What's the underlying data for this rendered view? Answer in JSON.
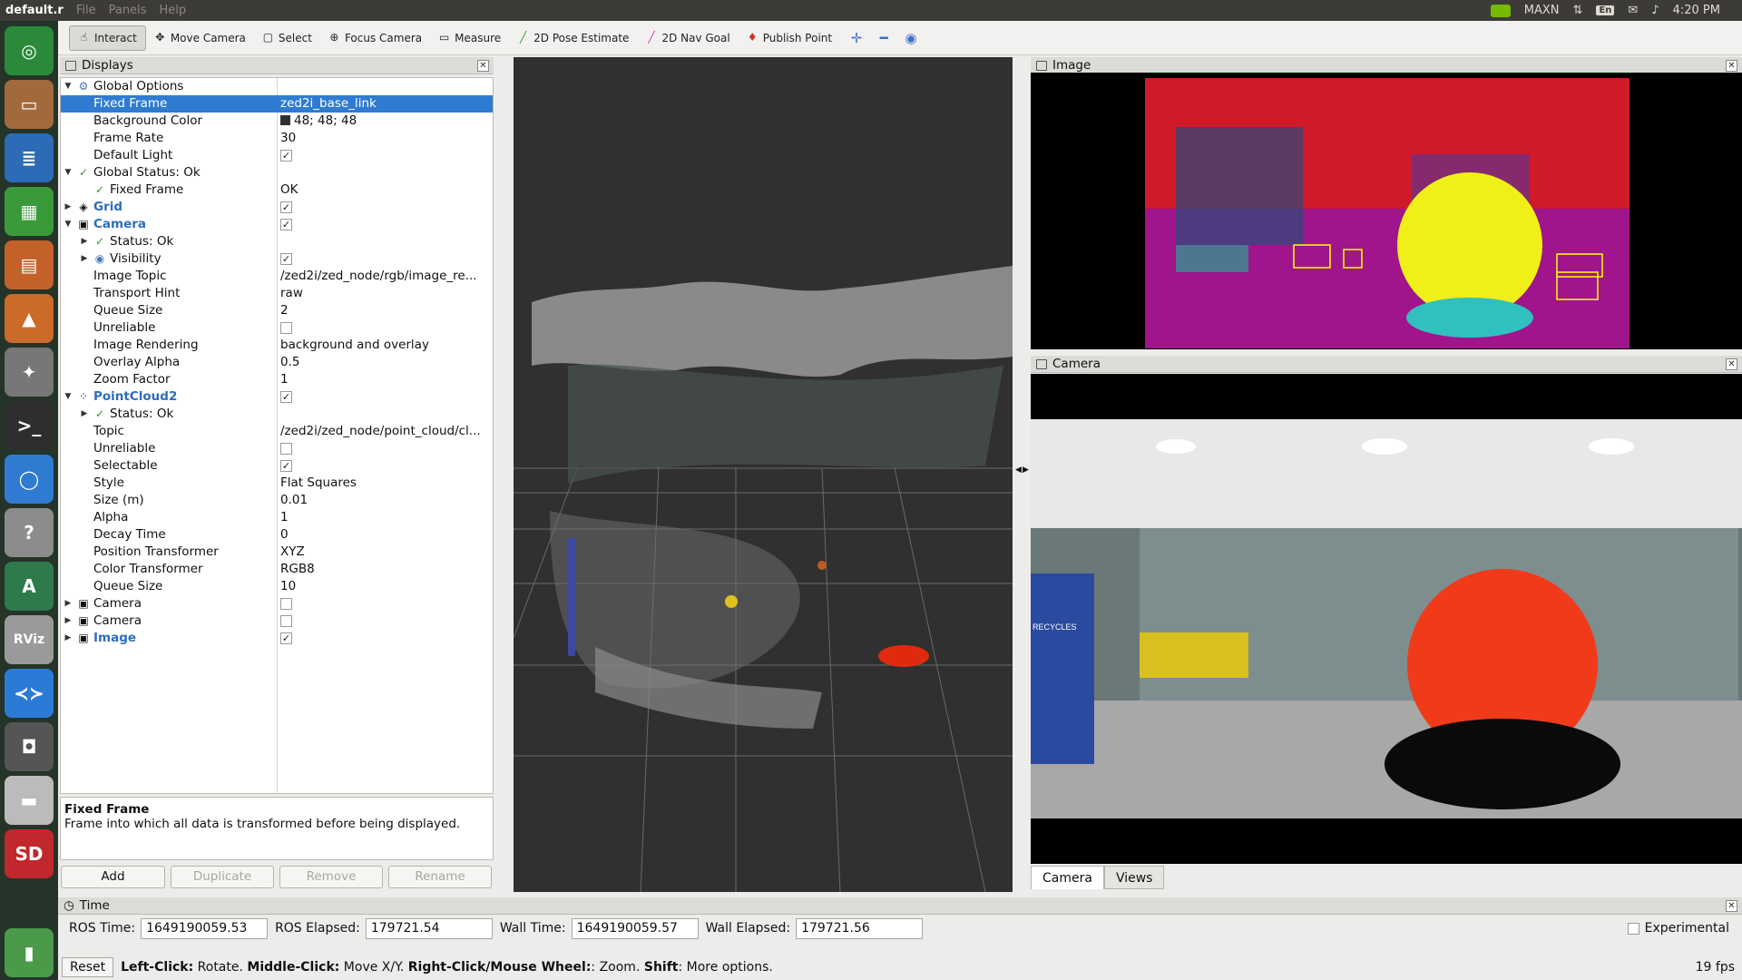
{
  "topbar": {
    "window_title": "default.r",
    "menus": [
      "File",
      "Panels",
      "Help"
    ],
    "nv_label": "MAXN",
    "lang": "En",
    "clock": "4:20 PM"
  },
  "toolbar": {
    "tools": [
      {
        "label": "Interact",
        "icon": "hand-cursor-icon",
        "active": true
      },
      {
        "label": "Move Camera",
        "icon": "move-arrows-icon"
      },
      {
        "label": "Select",
        "icon": "select-box-icon"
      },
      {
        "label": "Focus Camera",
        "icon": "focus-target-icon"
      },
      {
        "label": "Measure",
        "icon": "ruler-icon"
      },
      {
        "label": "2D Pose Estimate",
        "icon": "green-arrow-icon"
      },
      {
        "label": "2D Nav Goal",
        "icon": "pink-arrow-icon"
      },
      {
        "label": "Publish Point",
        "icon": "pin-icon"
      }
    ]
  },
  "displays": {
    "title": "Displays",
    "rows": [
      {
        "name": "Global Options",
        "value": "",
        "arrow": "▼",
        "icon": "⚙",
        "indent": 0,
        "icon_color": "#4a7ab6"
      },
      {
        "name": "Fixed Frame",
        "value": "zed2i_base_link",
        "indent": 1,
        "selected": true
      },
      {
        "name": "Background Color",
        "value": "48; 48; 48",
        "indent": 1,
        "swatch": true
      },
      {
        "name": "Frame Rate",
        "value": "30",
        "indent": 1
      },
      {
        "name": "Default Light",
        "value": "",
        "checked": true,
        "indent": 1
      },
      {
        "name": "Global Status: Ok",
        "value": "",
        "arrow": "▼",
        "icon": "✓",
        "indent": 0,
        "icon_color": "#2a9a2a"
      },
      {
        "name": "Fixed Frame",
        "value": "OK",
        "icon": "✓",
        "indent": 1,
        "icon_color": "#2a9a2a"
      },
      {
        "name": "Grid",
        "value": "",
        "arrow": "▶",
        "icon": "◈",
        "blue": true,
        "checked": true,
        "indent": 0
      },
      {
        "name": "Camera",
        "value": "",
        "arrow": "▼",
        "icon": "▣",
        "blue": true,
        "checked": true,
        "indent": 0
      },
      {
        "name": "Status: Ok",
        "value": "",
        "arrow": "▶",
        "icon": "✓",
        "indent": 1,
        "icon_color": "#2a9a2a"
      },
      {
        "name": "Visibility",
        "value": "",
        "arrow": "▶",
        "icon": "◉",
        "checked": true,
        "indent": 1,
        "icon_color": "#4a7ab6"
      },
      {
        "name": "Image Topic",
        "value": "/zed2i/zed_node/rgb/image_re...",
        "indent": 1
      },
      {
        "name": "Transport Hint",
        "value": "raw",
        "indent": 1
      },
      {
        "name": "Queue Size",
        "value": "2",
        "indent": 1
      },
      {
        "name": "Unreliable",
        "value": "",
        "checked": false,
        "indent": 1
      },
      {
        "name": "Image Rendering",
        "value": "background and overlay",
        "indent": 1
      },
      {
        "name": "Overlay Alpha",
        "value": "0.5",
        "indent": 1
      },
      {
        "name": "Zoom Factor",
        "value": "1",
        "indent": 1
      },
      {
        "name": "PointCloud2",
        "value": "",
        "arrow": "▼",
        "icon": "⁘",
        "blue": true,
        "checked": true,
        "indent": 0
      },
      {
        "name": "Status: Ok",
        "value": "",
        "arrow": "▶",
        "icon": "✓",
        "indent": 1,
        "icon_color": "#2a9a2a"
      },
      {
        "name": "Topic",
        "value": "/zed2i/zed_node/point_cloud/cl...",
        "indent": 1
      },
      {
        "name": "Unreliable",
        "value": "",
        "checked": false,
        "indent": 1
      },
      {
        "name": "Selectable",
        "value": "",
        "checked": true,
        "indent": 1
      },
      {
        "name": "Style",
        "value": "Flat Squares",
        "indent": 1
      },
      {
        "name": "Size (m)",
        "value": "0.01",
        "indent": 1
      },
      {
        "name": "Alpha",
        "value": "1",
        "indent": 1
      },
      {
        "name": "Decay Time",
        "value": "0",
        "indent": 1
      },
      {
        "name": "Position Transformer",
        "value": "XYZ",
        "indent": 1
      },
      {
        "name": "Color Transformer",
        "value": "RGB8",
        "indent": 1
      },
      {
        "name": "Queue Size",
        "value": "10",
        "indent": 1
      },
      {
        "name": "Camera",
        "value": "",
        "arrow": "▶",
        "icon": "▣",
        "checked": false,
        "indent": 0
      },
      {
        "name": "Camera",
        "value": "",
        "arrow": "▶",
        "icon": "▣",
        "checked": false,
        "indent": 0
      },
      {
        "name": "Image",
        "value": "",
        "arrow": "▶",
        "icon": "▣",
        "blue": true,
        "checked": true,
        "indent": 0
      }
    ],
    "desc_title": "Fixed Frame",
    "desc_text": "Frame into which all data is transformed before being displayed.",
    "buttons": {
      "add": "Add",
      "duplicate": "Duplicate",
      "remove": "Remove",
      "rename": "Rename"
    }
  },
  "image_panel": {
    "title": "Image"
  },
  "camera_panel": {
    "title": "Camera",
    "tabs": [
      "Camera",
      "Views"
    ]
  },
  "overlay_text": "RECYCLES",
  "time": {
    "title": "Time",
    "ros_time_label": "ROS Time:",
    "ros_time": "1649190059.53",
    "ros_elapsed_label": "ROS Elapsed:",
    "ros_elapsed": "179721.54",
    "wall_time_label": "Wall Time:",
    "wall_time": "1649190059.57",
    "wall_elapsed_label": "Wall Elapsed:",
    "wall_elapsed": "179721.56",
    "experimental": "Experimental"
  },
  "status": {
    "reset": "Reset",
    "k1": "Left-Click:",
    "v1": " Rotate. ",
    "k2": "Middle-Click:",
    "v2": " Move X/Y. ",
    "k3": "Right-Click/Mouse Wheel:",
    "v3": ": Zoom. ",
    "k4": "Shift",
    "v4": ": More options.",
    "fps": "19 fps"
  },
  "launcher": [
    {
      "icon": "ubuntu-logo-icon",
      "color": "#2a8a3a",
      "glyph": "◎"
    },
    {
      "icon": "file-manager-icon",
      "color": "#a26a3c",
      "glyph": "▭"
    },
    {
      "icon": "writer-icon",
      "color": "#2c6bb6",
      "glyph": "≣"
    },
    {
      "icon": "calc-icon",
      "color": "#3a9a3a",
      "glyph": "▦"
    },
    {
      "icon": "impress-icon",
      "color": "#c4612b",
      "glyph": "▤"
    },
    {
      "icon": "software-center-icon",
      "color": "#cc6a2a",
      "glyph": "▲"
    },
    {
      "icon": "settings-icon",
      "color": "#777",
      "glyph": "✦"
    },
    {
      "icon": "terminal-icon",
      "color": "#2e2e2e",
      "glyph": ">_"
    },
    {
      "icon": "chromium-icon",
      "color": "#2f7bd1",
      "glyph": "◯"
    },
    {
      "icon": "help-icon",
      "color": "#8c8c8c",
      "glyph": "?"
    },
    {
      "icon": "updater-icon",
      "color": "#2f7a4c",
      "glyph": "A"
    },
    {
      "icon": "rviz-icon",
      "color": "#9a9a9a",
      "glyph": "RViz"
    },
    {
      "icon": "vscode-icon",
      "color": "#2b7bd6",
      "glyph": "≺≻"
    },
    {
      "icon": "screenshot-icon",
      "color": "#555",
      "glyph": "◘"
    },
    {
      "icon": "drive-icon",
      "color": "#bbb",
      "glyph": "▬"
    },
    {
      "icon": "sd-card-icon",
      "color": "#c0282e",
      "glyph": "SD"
    },
    {
      "icon": "trash-icon",
      "color": "#4a9a4a",
      "glyph": "▮"
    }
  ]
}
